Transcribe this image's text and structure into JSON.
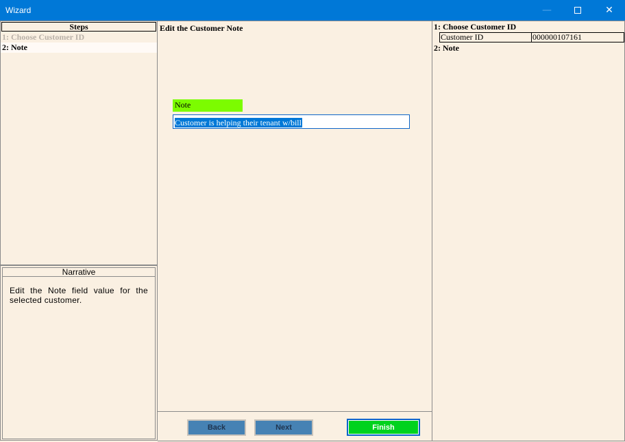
{
  "window": {
    "title": "Wizard",
    "minimize_glyph": "—",
    "close_glyph": "✕"
  },
  "steps": {
    "header": "Steps",
    "items": [
      {
        "label": "1: Choose Customer ID",
        "state": "done"
      },
      {
        "label": "2: Note",
        "state": "current"
      }
    ]
  },
  "narrative": {
    "header": "Narrative",
    "text": "Edit the Note field value for the selected customer."
  },
  "main": {
    "title": "Edit the Customer Note",
    "note_label": "Note",
    "note_value": "Customer is helping their tenant w/bill"
  },
  "buttons": {
    "back": "Back",
    "next": "Next",
    "finish": "Finish"
  },
  "summary": {
    "step1_title": "1: Choose Customer ID",
    "customer_id_label": "Customer ID",
    "customer_id_value": "000000107161",
    "step2_title": "2: Note"
  },
  "colors": {
    "titlebar": "#0078d7",
    "background": "#faf0e2",
    "note_label_bg": "#7cfc00",
    "nav_button": "#4682b4",
    "finish_button": "#00d21e"
  }
}
